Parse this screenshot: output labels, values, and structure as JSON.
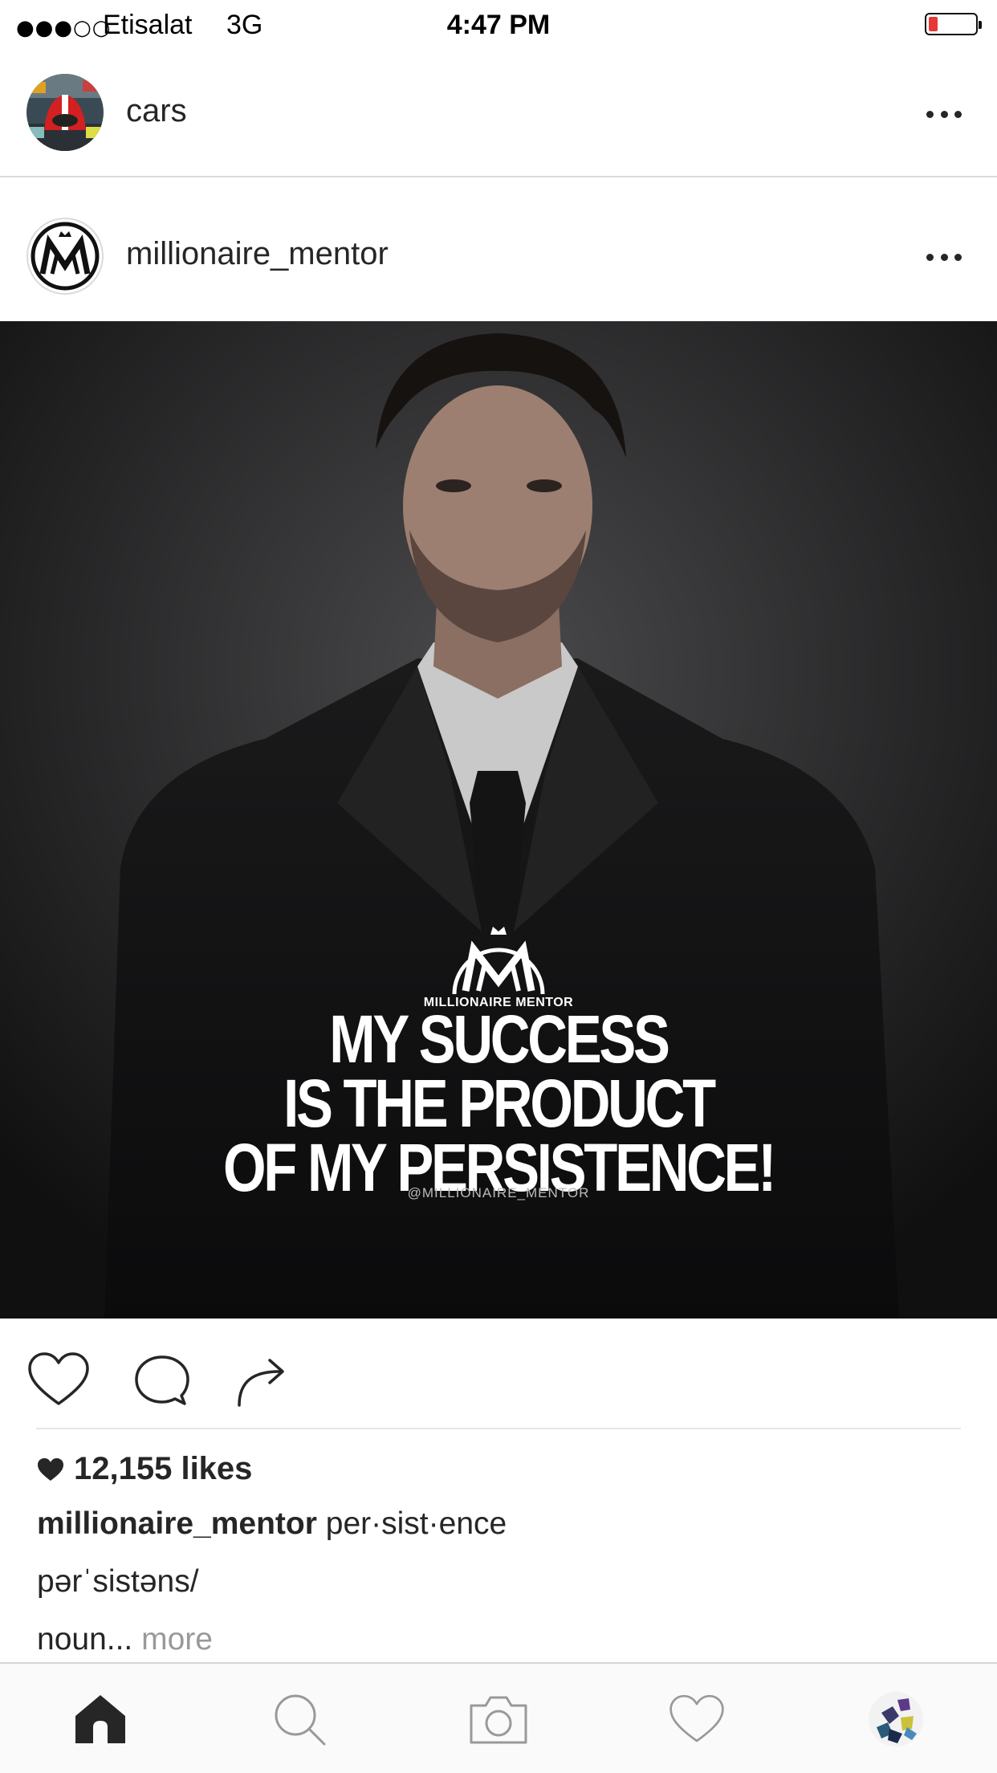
{
  "status_bar": {
    "signal": "●●●○○",
    "carrier": "Etisalat",
    "network": "3G",
    "time": "4:47 PM",
    "battery_level": 0.2,
    "battery_color": "#e53935"
  },
  "story_header": {
    "username": "cars",
    "more_icon": "more-horizontal-icon"
  },
  "post": {
    "username": "millionaire_mentor",
    "more_icon": "more-horizontal-icon",
    "image": {
      "logo_caption": "MILLIONAIRE MENTOR",
      "quote_lines": [
        "MY SUCCESS",
        "IS THE PRODUCT",
        "OF MY PERSISTENCE!"
      ],
      "watermark": "@MILLIONAIRE_MENTOR"
    },
    "actions": {
      "like_icon": "heart-icon",
      "comment_icon": "comment-icon",
      "share_icon": "share-icon"
    },
    "likes": "12,155 likes",
    "caption": {
      "author": "millionaire_mentor",
      "line1": "per·sist·ence",
      "line2": "pərˈsistəns/",
      "line3": "noun...",
      "more": "more"
    }
  },
  "tab_bar": {
    "items": [
      "home-icon",
      "search-icon",
      "camera-icon",
      "activity-heart-icon",
      "profile-avatar"
    ],
    "active": "home-icon"
  }
}
